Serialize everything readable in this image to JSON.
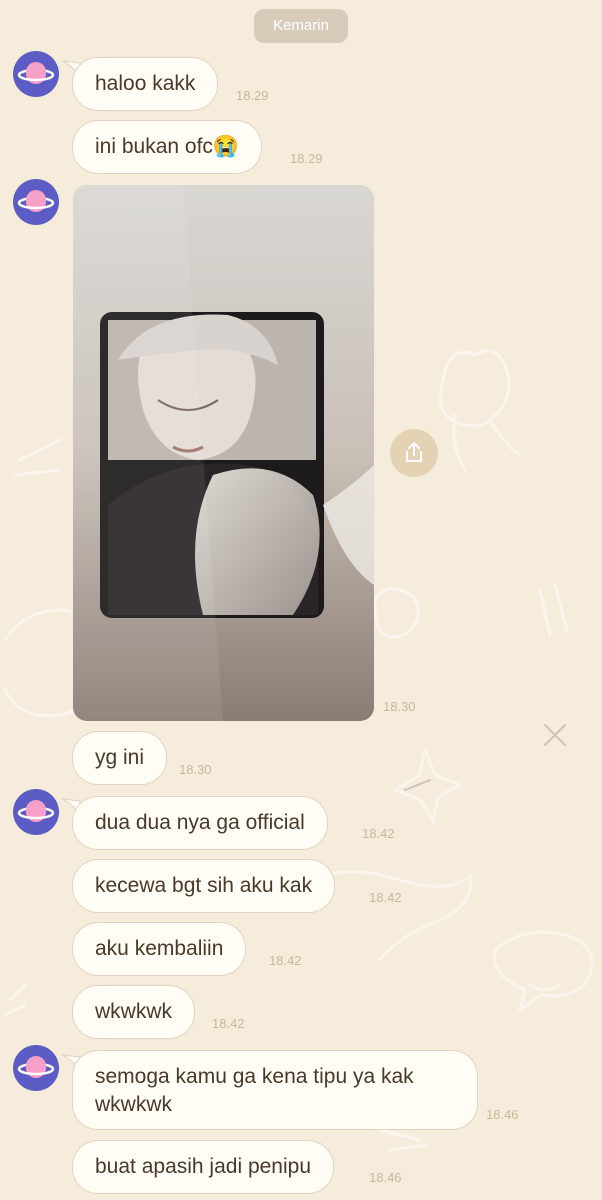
{
  "date_label": "Kemarin",
  "messages": [
    {
      "text": "haloo kakk",
      "time": "18.29"
    },
    {
      "text": "ini bukan ofc😭",
      "time": "18.29"
    },
    {
      "photo_time": "18.30"
    },
    {
      "text": "yg ini",
      "time": "18.30"
    },
    {
      "text": "dua dua nya ga official",
      "time": "18.42"
    },
    {
      "text": "kecewa bgt sih aku kak",
      "time": "18.42"
    },
    {
      "text": "aku kembaliin",
      "time": "18.42"
    },
    {
      "text": "wkwkwk",
      "time": "18.42"
    },
    {
      "text": "semoga kamu ga kena tipu ya kak wkwkwk",
      "time": "18.46"
    },
    {
      "text": "buat apasih jadi penipu",
      "time": "18.46"
    }
  ],
  "icons": {
    "avatar": "planet-icon",
    "share": "share-icon"
  },
  "colors": {
    "background": "#f6ecdc",
    "bubble": "#fffdf6",
    "avatar": "#5b5dc4",
    "time": "#c8b89a"
  }
}
